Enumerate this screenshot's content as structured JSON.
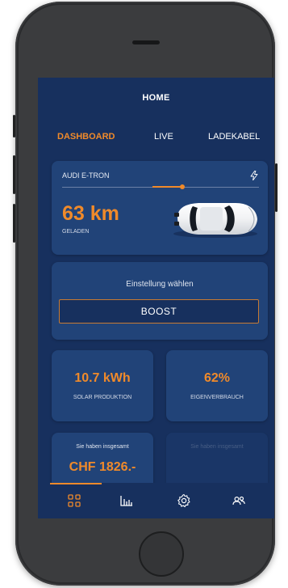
{
  "app": {
    "title": "HOME",
    "accent_color": "#f08a2a",
    "background_color": "#17305e",
    "card_color": "#214378"
  },
  "tabs": [
    {
      "label": "DASHBOARD",
      "active": true
    },
    {
      "label": "LIVE",
      "active": false
    },
    {
      "label": "LADEKABEL",
      "active": false
    }
  ],
  "vehicle": {
    "name": "AUDI E-TRON",
    "icon": "lightning-bolt-icon",
    "charge_level": 0.61,
    "range_value": "63 km",
    "range_label": "GELADEN",
    "image": "white-car-top-view"
  },
  "setting": {
    "label": "Einstellung wählen",
    "selected_mode": "BOOST"
  },
  "stats": {
    "solar": {
      "value": "10.7 kWh",
      "label": "SOLAR PRODUKTION"
    },
    "self_consumption": {
      "value": "62%",
      "label": "EIGENVERBRAUCH"
    }
  },
  "savings": {
    "caption": "Sie haben insgesamt",
    "value": "CHF 1826.-",
    "caption_2": "Sie haben insgesamt"
  },
  "bottom_nav": [
    {
      "icon": "dashboard-grid-icon",
      "active": true
    },
    {
      "icon": "bar-chart-icon",
      "active": false
    },
    {
      "icon": "gear-icon",
      "active": false
    },
    {
      "icon": "users-icon",
      "active": false
    }
  ]
}
